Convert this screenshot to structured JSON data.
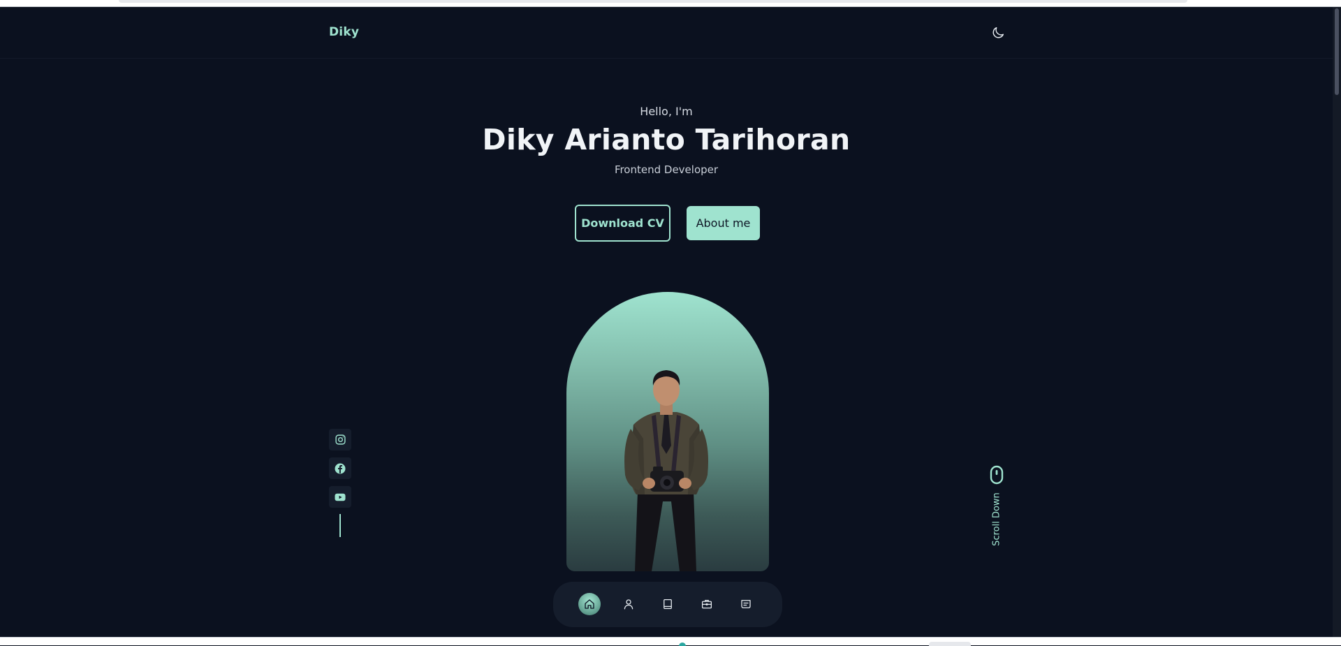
{
  "header": {
    "logo": "Diky",
    "theme_toggle_icon": "moon-icon"
  },
  "hero": {
    "greeting": "Hello, I'm",
    "name": "Diky Arianto Tarihoran",
    "role": "Frontend Developer",
    "download_cv_label": "Download CV",
    "about_me_label": "About me"
  },
  "social": [
    "instagram-icon",
    "facebook-icon",
    "youtube-icon"
  ],
  "scroll": {
    "label": "Scroll Down",
    "icon": "mouse-icon"
  },
  "bottom_nav": [
    {
      "icon": "home-icon",
      "active": true
    },
    {
      "icon": "user-icon",
      "active": false
    },
    {
      "icon": "book-icon",
      "active": false
    },
    {
      "icon": "briefcase-icon",
      "active": false
    },
    {
      "icon": "message-icon",
      "active": false
    }
  ],
  "colors": {
    "background": "#0b111f",
    "accent": "#9fe3cf",
    "surface": "#151d2c",
    "text": "#f1f4f7"
  }
}
